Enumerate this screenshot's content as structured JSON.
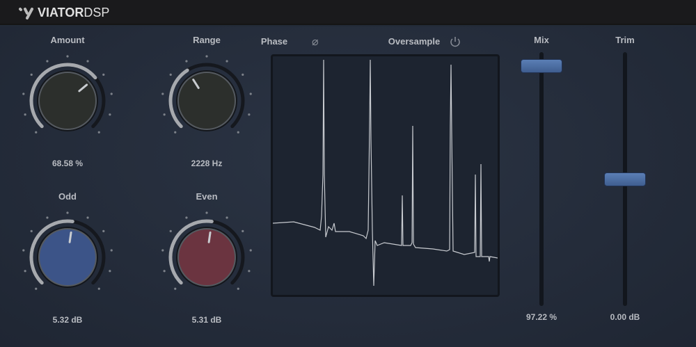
{
  "brand": {
    "name_bold": "VIATOR",
    "name_light": "DSP"
  },
  "knobs": [
    {
      "id": "amount",
      "label": "Amount",
      "value": "68.58 %",
      "fraction": 0.6858,
      "fill": "#2c2f2c"
    },
    {
      "id": "range",
      "label": "Range",
      "value": "2228 Hz",
      "fraction": 0.38,
      "fill": "#2c2f2c"
    },
    {
      "id": "odd",
      "label": "Odd",
      "value": "5.32 dB",
      "fraction": 0.53,
      "fill": "#3c5488"
    },
    {
      "id": "even",
      "label": "Even",
      "value": "5.31 dB",
      "fraction": 0.53,
      "fill": "#6b3440"
    }
  ],
  "display": {
    "phase_label": "Phase",
    "phase_icon": "phase-invert-icon",
    "oversample_label": "Oversample",
    "oversample_icon": "power-icon"
  },
  "sliders": [
    {
      "id": "mix",
      "label": "Mix",
      "value": "97.22 %",
      "fraction": 0.9722
    },
    {
      "id": "trim",
      "label": "Trim",
      "value": "0.00 dB",
      "fraction": 0.5
    }
  ]
}
